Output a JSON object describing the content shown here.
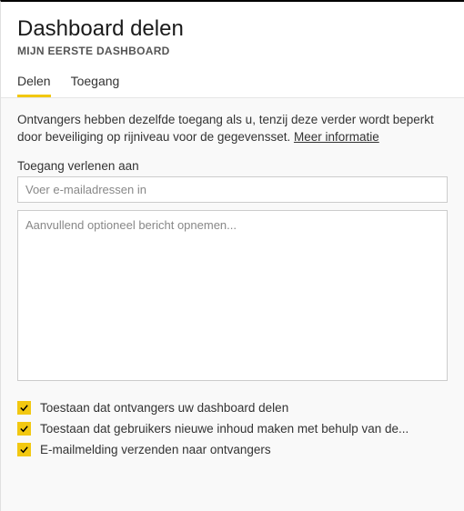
{
  "header": {
    "title": "Dashboard delen",
    "subtitle": "MIJN EERSTE DASHBOARD"
  },
  "tabs": {
    "share": "Delen",
    "access": "Toegang"
  },
  "content": {
    "description_part1": "Ontvangers hebben dezelfde toegang als u, tenzij deze verder wordt beperkt door beveiliging op rijniveau voor de gegevensset. ",
    "more_info": "Meer informatie",
    "grant_access_label": "Toegang verlenen aan",
    "email_placeholder": "Voer e-mailadressen in",
    "message_placeholder": "Aanvullend optioneel bericht opnemen..."
  },
  "options": {
    "allow_reshare": "Toestaan dat ontvangers uw dashboard delen",
    "allow_build": "Toestaan dat gebruikers nieuwe inhoud maken met behulp van de...",
    "send_email": "E-mailmelding verzenden naar ontvangers"
  }
}
